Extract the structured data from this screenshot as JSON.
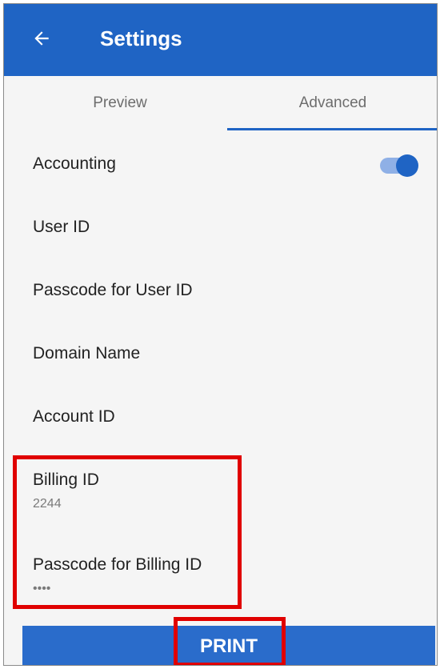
{
  "appbar": {
    "title": "Settings",
    "back_icon": "arrow-left-icon"
  },
  "tabs": [
    {
      "label": "Preview",
      "selected": false
    },
    {
      "label": "Advanced",
      "selected": true
    }
  ],
  "settings": {
    "accounting": {
      "label": "Accounting",
      "enabled": true
    },
    "user_id": {
      "label": "User ID"
    },
    "passcode_user_id": {
      "label": "Passcode for User ID"
    },
    "domain_name": {
      "label": "Domain Name"
    },
    "account_id": {
      "label": "Account ID"
    },
    "billing_id": {
      "label": "Billing ID",
      "value": "2244"
    },
    "passcode_billing_id": {
      "label": "Passcode for Billing ID",
      "value": "••••"
    }
  },
  "footer": {
    "print_label": "PRINT"
  },
  "colors": {
    "primary": "#1f64c4",
    "highlight": "#e00000",
    "toggle_track": "#8fb0e6"
  }
}
